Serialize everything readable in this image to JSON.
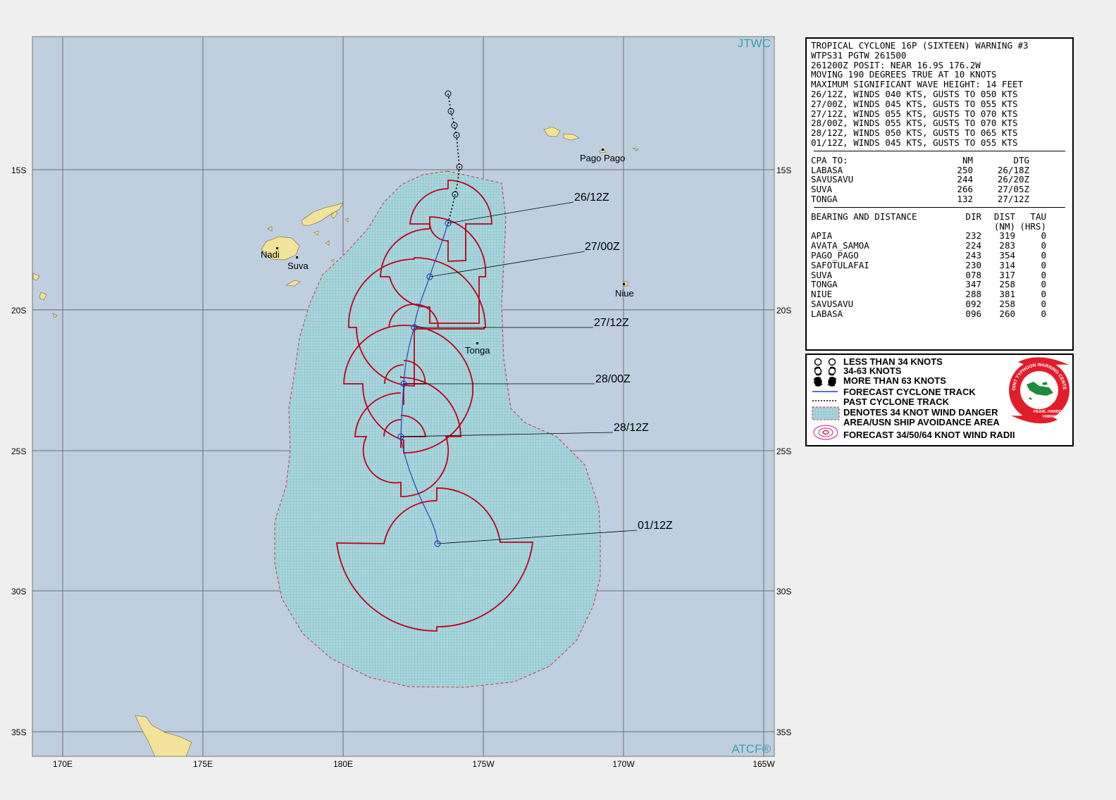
{
  "map": {
    "agency_tag": "JTWC",
    "atcf_tag": "ATCF®",
    "lat_labels": [
      "15S",
      "20S",
      "25S",
      "30S",
      "35S"
    ],
    "lon_labels": [
      "170E",
      "175E",
      "180E",
      "175W",
      "170W",
      "165W"
    ],
    "places": {
      "pago_pago": "Pago Pago",
      "nadi": "Nadi",
      "suva": "Suva",
      "niue": "Niue",
      "tonga": "Tonga"
    },
    "forecast_labels": [
      "26/12Z",
      "27/00Z",
      "27/12Z",
      "28/00Z",
      "28/12Z",
      "01/12Z"
    ],
    "colors": {
      "ocean": "#bfcfe0",
      "land": "#f3e39a",
      "danger_area": "#9fcfd6",
      "wind_radii": "#c00018",
      "forecast_track": "#2a3fb8",
      "grid": "#6e6e6e",
      "tag_text": "#3aa0a8"
    }
  },
  "warning": {
    "header_lines": [
      "TROPICAL CYCLONE 16P (SIXTEEN) WARNING #3",
      "WTPS31 PGTW 261500",
      "261200Z POSIT: NEAR 16.9S 176.2W",
      "MOVING 190 DEGREES TRUE AT 10 KNOTS",
      "MAXIMUM SIGNIFICANT WAVE HEIGHT: 14 FEET",
      "26/12Z, WINDS 040 KTS, GUSTS TO 050 KTS",
      "27/00Z, WINDS 045 KTS, GUSTS TO 055 KTS",
      "27/12Z, WINDS 055 KTS, GUSTS TO 070 KTS",
      "28/00Z, WINDS 055 KTS, GUSTS TO 070 KTS",
      "28/12Z, WINDS 050 KTS, GUSTS TO 065 KTS",
      "01/12Z, WINDS 045 KTS, GUSTS TO 055 KTS"
    ],
    "cpa": {
      "title": "CPA TO:",
      "col_nm": "NM",
      "col_dtg": "DTG",
      "rows": [
        {
          "name": "LABASA",
          "nm": "250",
          "dtg": "26/18Z"
        },
        {
          "name": "SAVUSAVU",
          "nm": "244",
          "dtg": "26/20Z"
        },
        {
          "name": "SUVA",
          "nm": "266",
          "dtg": "27/05Z"
        },
        {
          "name": "TONGA",
          "nm": "132",
          "dtg": "27/12Z"
        }
      ]
    },
    "bearing": {
      "title": "BEARING AND DISTANCE",
      "col_dir": "DIR",
      "col_dist": "DIST",
      "col_tau": "TAU",
      "unit_dist": "(NM)",
      "unit_tau": "(HRS)",
      "rows": [
        {
          "name": "APIA",
          "dir": "232",
          "dist": "319",
          "tau": "0"
        },
        {
          "name": "AVATA_SAMOA",
          "dir": "224",
          "dist": "283",
          "tau": "0"
        },
        {
          "name": "PAGO_PAGO",
          "dir": "243",
          "dist": "354",
          "tau": "0"
        },
        {
          "name": "SAFOTULAFAI",
          "dir": "230",
          "dist": "314",
          "tau": "0"
        },
        {
          "name": "SUVA",
          "dir": "078",
          "dist": "317",
          "tau": "0"
        },
        {
          "name": "TONGA",
          "dir": "347",
          "dist": "258",
          "tau": "0"
        },
        {
          "name": "NIUE",
          "dir": "288",
          "dist": "381",
          "tau": "0"
        },
        {
          "name": "SAVUSAVU",
          "dir": "092",
          "dist": "258",
          "tau": "0"
        },
        {
          "name": "LABASA",
          "dir": "096",
          "dist": "260",
          "tau": "0"
        }
      ]
    }
  },
  "legend": {
    "items": [
      {
        "icon": "less-than-34-knots-icon",
        "label": "LESS THAN 34 KNOTS"
      },
      {
        "icon": "34-63-knots-icon",
        "label": "34-63 KNOTS"
      },
      {
        "icon": "more-than-63-knots-icon",
        "label": "MORE THAN 63 KNOTS"
      },
      {
        "icon": "forecast-track-icon",
        "label": "FORECAST CYCLONE TRACK"
      },
      {
        "icon": "past-track-icon",
        "label": "PAST CYCLONE TRACK"
      },
      {
        "icon": "danger-area-icon",
        "label": "DENOTES 34 KNOT WIND DANGER"
      },
      {
        "icon": "",
        "label": "AREA/USN SHIP AVOIDANCE AREA"
      },
      {
        "icon": "wind-radii-icon",
        "label": "FORECAST 34/50/64 KNOT WIND RADII"
      }
    ],
    "seal": {
      "top": "JOINT TYPHOON WARNING CENTER",
      "bottom": "PEARL HARBOR",
      "state": "HAWAII"
    }
  }
}
